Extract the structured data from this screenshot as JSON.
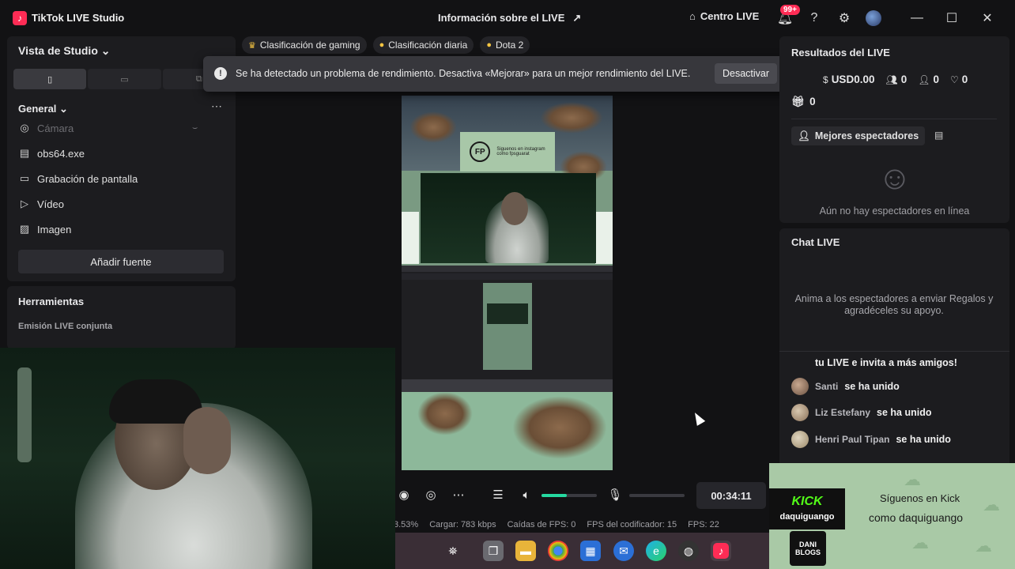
{
  "window": {
    "app_title": "TikTok LIVE Studio",
    "center_title": "Información sobre el LIVE",
    "share_icon": "share-icon",
    "home_label": "Centro LIVE",
    "notif_badge": "99+"
  },
  "left": {
    "studio_view_label": "Vista de Studio",
    "section_label": "General",
    "sources": [
      {
        "label": "Cámara",
        "icon": "camera-icon",
        "disabled": true
      },
      {
        "label": "obs64.exe",
        "icon": "window-icon",
        "disabled": false
      },
      {
        "label": "Grabación de pantalla",
        "icon": "monitor-icon",
        "disabled": false
      },
      {
        "label": "Vídeo",
        "icon": "play-icon",
        "disabled": false
      },
      {
        "label": "Imagen",
        "icon": "image-icon",
        "disabled": false
      }
    ],
    "add_source_label": "Añadir fuente",
    "tools_title": "Herramientas",
    "tools_sub": "Emisión LIVE conjunta"
  },
  "center": {
    "chips": [
      {
        "label": "Clasificación de gaming"
      },
      {
        "label": "Clasificación diaria"
      },
      {
        "label": "Dota 2"
      }
    ],
    "toast": {
      "message": "Se ha detectado un problema de rendimiento. Desactiva «Mejorar» para un mejor rendimiento del LIVE.",
      "action_label": "Desactivar"
    },
    "preview": {
      "card_logo": "FP",
      "card_line1": "Siguenos en instagram",
      "card_line2": "como fpsguarat"
    },
    "volume_level": 0.45,
    "timer": "00:34:11",
    "stats": {
      "pct": "3.53%",
      "upload": "Cargar: 783 kbps",
      "fps_drops": "Caídas de FPS: 0",
      "encoder_fps": "FPS del codificador: 15",
      "fps": "FPS: 22"
    }
  },
  "right": {
    "results_title": "Resultados del LIVE",
    "stats": {
      "money": "USD0.00",
      "viewers": "0",
      "followers": "0",
      "likes": "0",
      "gifts": "0"
    },
    "top_viewers_label": "Mejores espectadores",
    "no_viewers": "Aún no hay espectadores en línea",
    "chat_title": "Chat LIVE",
    "chat_prompt": "Anima a los espectadores a enviar Regalos y agradéceles su apoyo.",
    "chat_first": "tu LIVE e invita a más amigos!",
    "messages": [
      {
        "name": "Santi",
        "action": "se ha unido"
      },
      {
        "name": "Liz Estefany",
        "action": "se ha unido"
      },
      {
        "name": "Henri Paul Tipan",
        "action": "se ha unido"
      }
    ]
  },
  "overlay": {
    "kick_brand": "KICK",
    "kick_user": "daquiguango",
    "kick_badge": "DANI BLOGS",
    "follow_line1": "Síguenos en Kick",
    "follow_line2": "como daquiguango"
  }
}
